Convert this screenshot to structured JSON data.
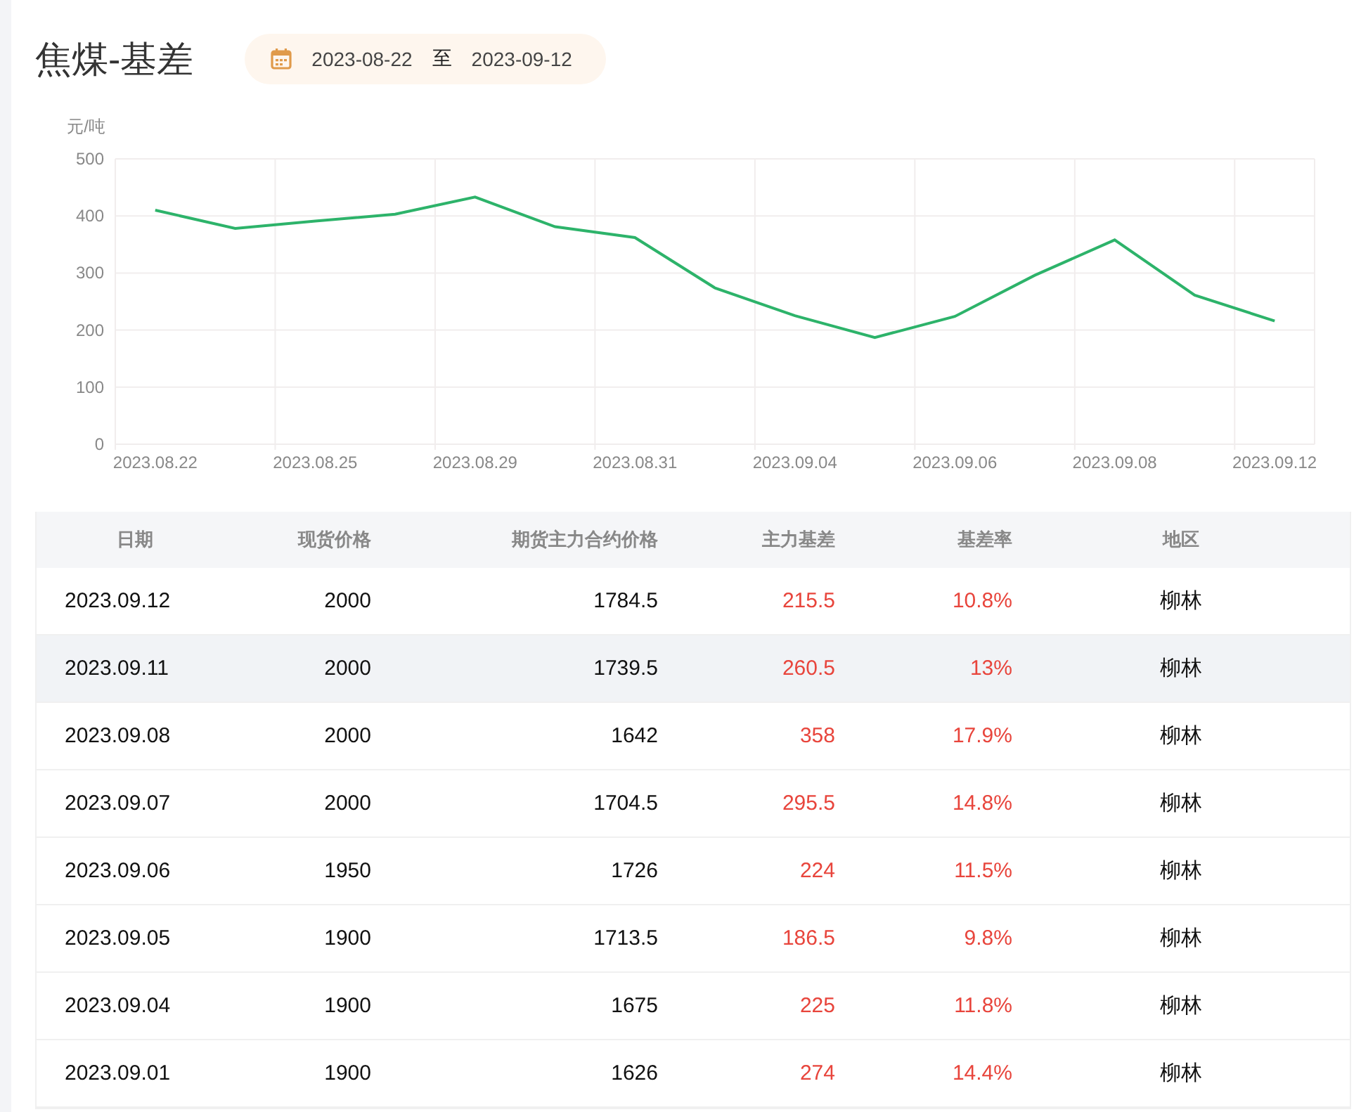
{
  "title": "焦煤-基差",
  "date_range": {
    "start": "2023-08-22",
    "separator": "至",
    "end": "2023-09-12"
  },
  "chart": {
    "chart_data": {
      "type": "line",
      "ylabel": "元/吨",
      "grid": true,
      "categories": [
        "2023.08.22",
        null,
        "2023.08.25",
        null,
        "2023.08.29",
        null,
        "2023.08.31",
        null,
        "2023.09.04",
        null,
        "2023.09.06",
        null,
        "2023.09.08",
        null,
        "2023.09.12"
      ],
      "series": [
        {
          "color": "#2db36a",
          "values": [
            410,
            378,
            391,
            403,
            433,
            381,
            362,
            274,
            225,
            187,
            224,
            296,
            358,
            261,
            216
          ]
        }
      ],
      "ylim": [
        0,
        500
      ],
      "yticks": [
        0,
        100,
        200,
        300,
        400,
        500
      ]
    }
  },
  "table": {
    "columns": [
      "日期",
      "现货价格",
      "期货主力合约价格",
      "主力基差",
      "基差率",
      "地区"
    ],
    "rows": [
      {
        "date": "2023.09.12",
        "spot": "2000",
        "futures": "1784.5",
        "basis": "215.5",
        "rate": "10.8%",
        "region": "柳林",
        "selected": false
      },
      {
        "date": "2023.09.11",
        "spot": "2000",
        "futures": "1739.5",
        "basis": "260.5",
        "rate": "13%",
        "region": "柳林",
        "selected": true
      },
      {
        "date": "2023.09.08",
        "spot": "2000",
        "futures": "1642",
        "basis": "358",
        "rate": "17.9%",
        "region": "柳林",
        "selected": false
      },
      {
        "date": "2023.09.07",
        "spot": "2000",
        "futures": "1704.5",
        "basis": "295.5",
        "rate": "14.8%",
        "region": "柳林",
        "selected": false
      },
      {
        "date": "2023.09.06",
        "spot": "1950",
        "futures": "1726",
        "basis": "224",
        "rate": "11.5%",
        "region": "柳林",
        "selected": false
      },
      {
        "date": "2023.09.05",
        "spot": "1900",
        "futures": "1713.5",
        "basis": "186.5",
        "rate": "9.8%",
        "region": "柳林",
        "selected": false
      },
      {
        "date": "2023.09.04",
        "spot": "1900",
        "futures": "1675",
        "basis": "225",
        "rate": "11.8%",
        "region": "柳林",
        "selected": false
      },
      {
        "date": "2023.09.01",
        "spot": "1900",
        "futures": "1626",
        "basis": "274",
        "rate": "14.4%",
        "region": "柳林",
        "selected": false
      }
    ]
  }
}
